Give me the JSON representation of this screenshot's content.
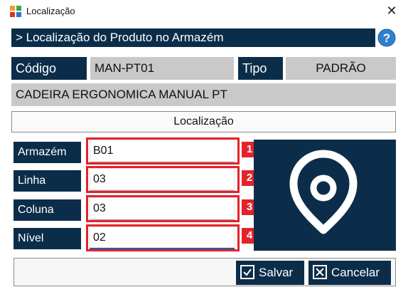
{
  "window": {
    "title": "Localização",
    "close_glyph": "✕"
  },
  "header": {
    "title": "> Localização do Produto no Armazém",
    "help_glyph": "?"
  },
  "product": {
    "code_label": "Código",
    "code_value": "MAN-PT01",
    "type_label": "Tipo",
    "type_value": "PADRÃO",
    "description": "CADEIRA ERGONOMICA MANUAL PT"
  },
  "location": {
    "section_title": "Localização",
    "fields": [
      {
        "label": "Armazém",
        "value": "B01",
        "badge": "1"
      },
      {
        "label": "Linha",
        "value": "03",
        "badge": "2"
      },
      {
        "label": "Coluna",
        "value": "03",
        "badge": "3"
      },
      {
        "label": "Nível",
        "value": "02",
        "badge": "4"
      }
    ]
  },
  "actions": {
    "save_label": "Salvar",
    "cancel_label": "Cancelar"
  },
  "colors": {
    "navy": "#0c2d4a",
    "highlight_red": "#e3222a",
    "field_grey": "#c9c9c9",
    "help_blue": "#2f7fd0"
  },
  "icons": {
    "app": "app-logo-icon",
    "help": "help-icon",
    "pin": "location-pin-icon",
    "save": "checkbox-check-icon",
    "cancel": "checkbox-x-icon"
  }
}
